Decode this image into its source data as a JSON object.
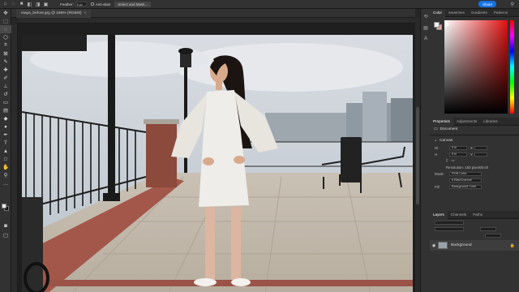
{
  "options_bar": {
    "feather_label": "Feather:",
    "feather_value": "0 px",
    "antialias_label": "Anti-alias",
    "select_mask_label": "Select and Mask...",
    "share_label": "Share"
  },
  "document": {
    "tab_title": "maya_before.jpg @ 186% (RGB/8)",
    "close_glyph": "×"
  },
  "color_panel": {
    "tabs": [
      "Color",
      "Swatches",
      "Gradients",
      "Patterns"
    ],
    "fg_color": "#eeeeee",
    "bg_color": "#e2a1a5"
  },
  "properties_panel": {
    "tabs": [
      "Properties",
      "Adjustments",
      "Libraries"
    ],
    "document_label": "Document",
    "canvas_label": "Canvas",
    "width_label": "W",
    "width_value": "9 in",
    "height_label": "H",
    "height_value": "5 in",
    "x_label": "X",
    "y_label": "Y",
    "resolution": "Resolution: 150 pixels/inch",
    "mode_label": "Mode",
    "mode_value": "RGB Color",
    "depth_value": "8 Bits/Channel",
    "fill_label": "Fill",
    "fill_value": "Background Color"
  },
  "layers_panel": {
    "tabs": [
      "Layers",
      "Channels",
      "Paths"
    ],
    "layer_name": "Background"
  }
}
